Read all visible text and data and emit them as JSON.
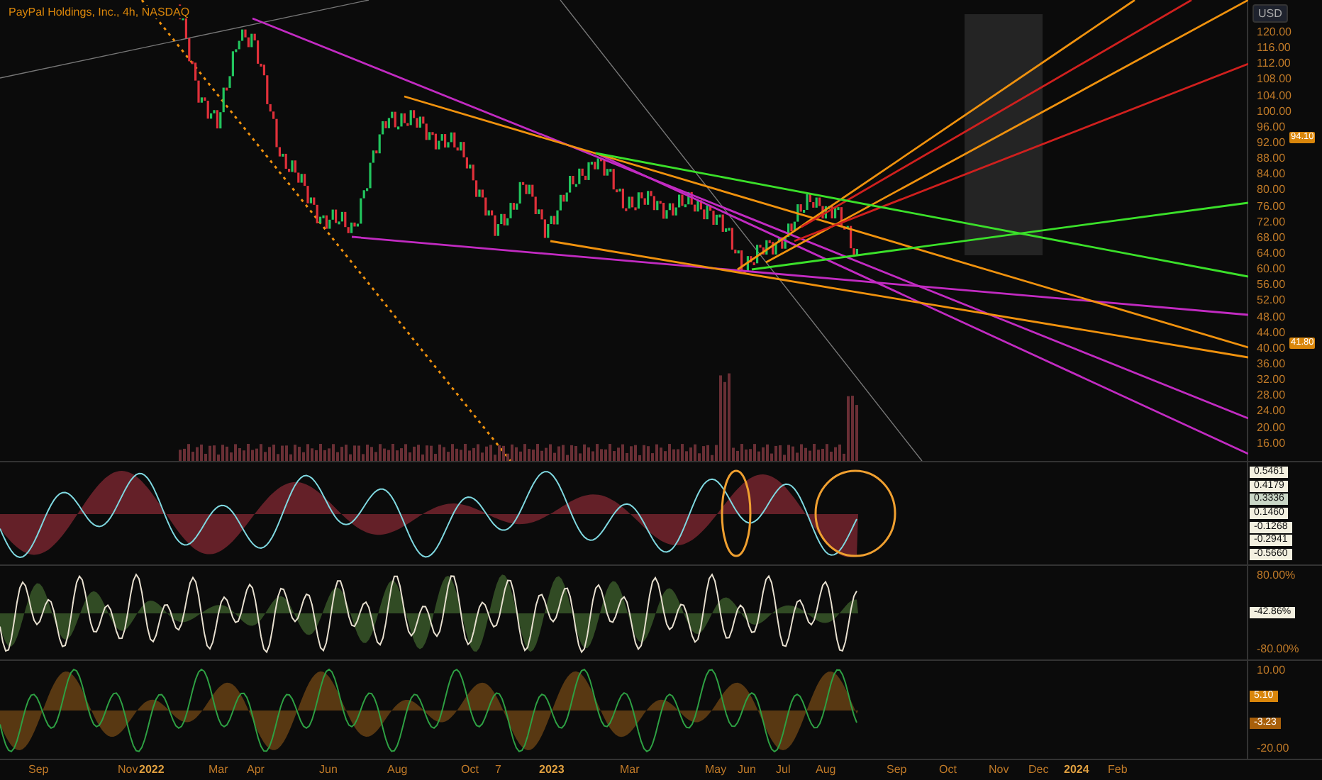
{
  "title": "PayPal Holdings, Inc., 4h, NASDAQ",
  "currency": "USD",
  "price_axis": {
    "ticks": [
      "120.00",
      "116.00",
      "112.00",
      "108.00",
      "104.00",
      "100.00",
      "96.00",
      "92.00",
      "88.00",
      "84.00",
      "80.00",
      "76.00",
      "72.00",
      "68.00",
      "64.00",
      "60.00",
      "56.00",
      "52.00",
      "48.00",
      "44.00",
      "40.00",
      "36.00",
      "32.00",
      "28.00",
      "24.00",
      "20.00",
      "16.00"
    ],
    "badges": [
      {
        "text": "94.10",
        "color": "#d9860b"
      },
      {
        "text": "41.80",
        "color": "#d9860b"
      }
    ]
  },
  "panes": [
    {
      "kind": "oscillator",
      "marks": [
        {
          "text": "0.5461",
          "kind": "badge",
          "color": "#f3f0e0"
        },
        {
          "text": "0.4179",
          "kind": "badge",
          "color": "#f3f0e0"
        },
        {
          "text": "0.3336",
          "kind": "badge",
          "color": "#c9d6c6"
        },
        {
          "text": "0.1460",
          "kind": "badge",
          "color": "#f3f0e0"
        },
        {
          "text": "-0.1268",
          "kind": "badge",
          "color": "#f3f0e0"
        },
        {
          "text": "-0.2941",
          "kind": "badge",
          "color": "#f3f0e0"
        },
        {
          "text": "-0.5660",
          "kind": "badge",
          "color": "#f3f0e0"
        }
      ]
    },
    {
      "kind": "percent",
      "marks": [
        {
          "text": "80.00%",
          "kind": "tick"
        },
        {
          "text": "-42.86%",
          "kind": "badge",
          "color": "#f3f0e0"
        },
        {
          "text": "-80.00%",
          "kind": "tick"
        }
      ]
    },
    {
      "kind": "momentum",
      "marks": [
        {
          "text": "10.00",
          "kind": "tick"
        },
        {
          "text": "5.10",
          "kind": "badge",
          "color": "#d9860b"
        },
        {
          "text": "-3.23",
          "kind": "badge",
          "color": "#a85f0a"
        },
        {
          "text": "-20.00",
          "kind": "tick"
        }
      ]
    }
  ],
  "time_axis": [
    {
      "label": "Sep",
      "kind": "month"
    },
    {
      "label": "Nov",
      "kind": "month"
    },
    {
      "label": "2022",
      "kind": "year"
    },
    {
      "label": "Mar",
      "kind": "month"
    },
    {
      "label": "Apr",
      "kind": "month"
    },
    {
      "label": "Jun",
      "kind": "month"
    },
    {
      "label": "Aug",
      "kind": "month"
    },
    {
      "label": "Oct",
      "kind": "month"
    },
    {
      "label": "7",
      "kind": "month"
    },
    {
      "label": "2023",
      "kind": "year"
    },
    {
      "label": "Mar",
      "kind": "month"
    },
    {
      "label": "May",
      "kind": "month"
    },
    {
      "label": "Jun",
      "kind": "month"
    },
    {
      "label": "Jul",
      "kind": "month"
    },
    {
      "label": "Aug",
      "kind": "month"
    },
    {
      "label": "Sep",
      "kind": "month"
    },
    {
      "label": "Oct",
      "kind": "month"
    },
    {
      "label": "Nov",
      "kind": "month"
    },
    {
      "label": "Dec",
      "kind": "month"
    },
    {
      "label": "2024",
      "kind": "year"
    },
    {
      "label": "Feb",
      "kind": "month"
    }
  ]
}
